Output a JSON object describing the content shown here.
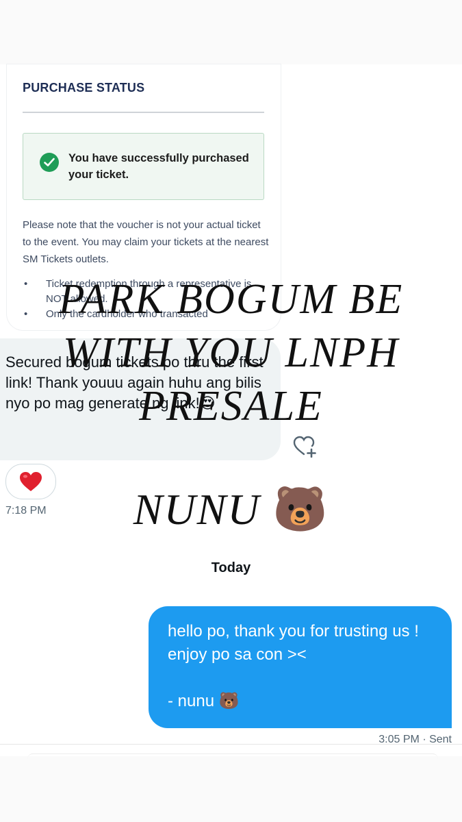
{
  "purchase_card": {
    "title": "PURCHASE STATUS",
    "success_message": "You have successfully purchased your ticket.",
    "note": "Please note that the voucher is not your actual ticket to the event. You may claim your tickets at the nearest SM Tickets outlets.",
    "bullets": [
      "Ticket redemption through a representative is NOT allowed.",
      "Only the cardholder who transacted"
    ],
    "accent_color": "#1f9d57"
  },
  "chat": {
    "incoming_message": "Secured bogum tickets po thru the first link! Thank youuu again huhu ang bilis nyo po mag generate ng link!😍",
    "reaction": "❤️",
    "incoming_time": "7:18 PM",
    "day_divider": "Today",
    "outgoing_message": "hello po, thank you for trusting us ! enjoy po sa con ><\n\n- nunu 🐻",
    "outgoing_meta": "3:05 PM · Sent",
    "bubble_color": "#1d9bf0"
  },
  "overlay": {
    "title": "PARK BOGUM BE WITH YOU LNPH PRESALE",
    "signature_text": "NUNU",
    "signature_emoji": "🐻"
  },
  "icons": {
    "reaction_add": "heart-plus-icon",
    "success": "check-circle-icon"
  }
}
